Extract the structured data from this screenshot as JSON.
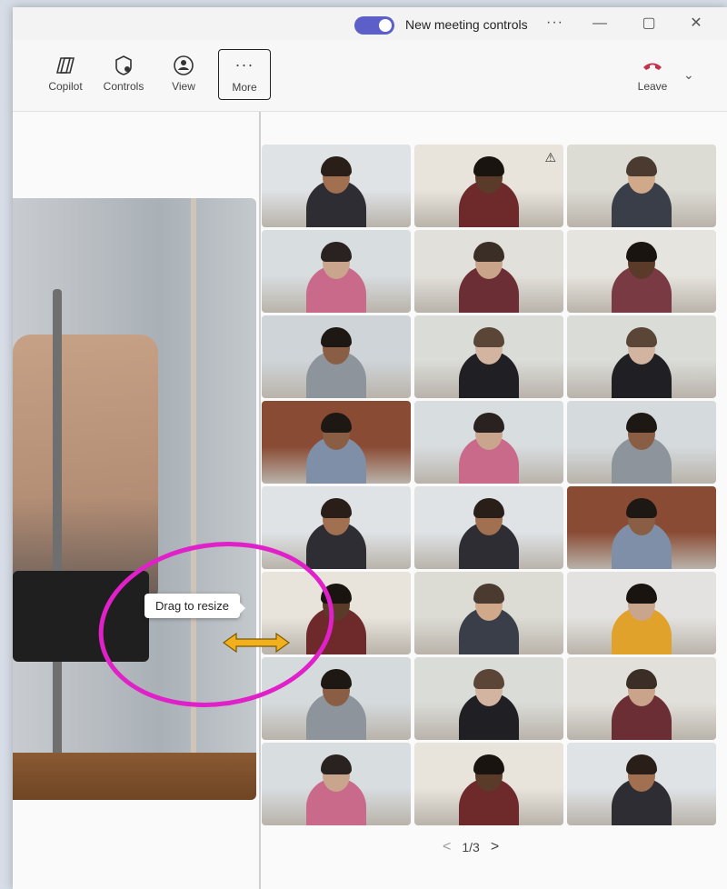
{
  "titlebar": {
    "toggle_on": true,
    "label": "New meeting controls",
    "more": "···",
    "minimize": "—",
    "maximize": "▢",
    "close": "✕"
  },
  "toolbar": {
    "copilot": "Copilot",
    "controls": "Controls",
    "view": "View",
    "more_glyph": "···",
    "more": "More",
    "leave": "Leave",
    "leave_color": "#c4314b"
  },
  "tooltip": "Drag to resize",
  "pager": {
    "prev": "<",
    "page": "1/3",
    "next": ">"
  },
  "colors": {
    "accent": "#5b5fc7",
    "callout": "#e020c8",
    "resize_arrow": "#f2b01e"
  }
}
